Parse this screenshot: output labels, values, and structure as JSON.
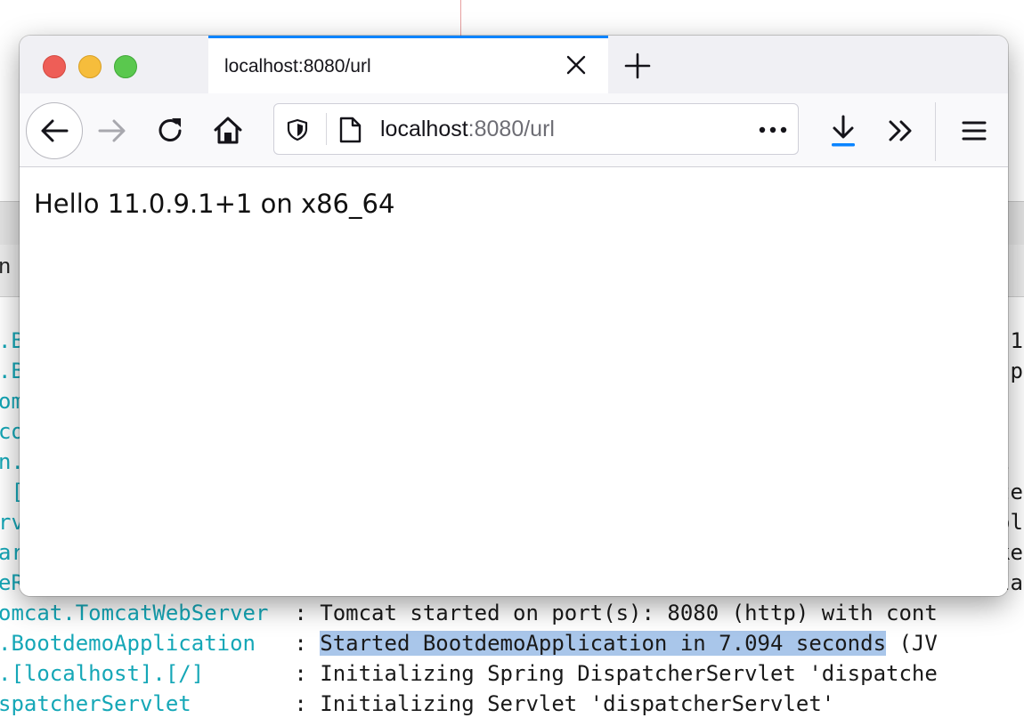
{
  "browser": {
    "tab": {
      "title": "localhost:8080/url"
    },
    "address": {
      "host": "localhost",
      "rest": ":8080/url"
    },
    "page": {
      "text": "Hello 11.0.9.1+1 on x86_64"
    }
  },
  "console": {
    "tab_label": "n (",
    "left_fragments": [
      ".B",
      ".B",
      "om",
      "co",
      "n.",
      " [",
      "rv",
      "ar",
      "eR"
    ],
    "right_fragments": [
      ".1",
      " p",
      "",
      "",
      "l",
      "te",
      "ol",
      "ke",
      "la"
    ],
    "lines": [
      {
        "logger": "omcat.TomcatWebServer  ",
        "sep": ": ",
        "msg": "Tomcat started on port(s): 8080 (http) with cont",
        "highlight": "",
        "tail": ""
      },
      {
        "logger": ".BootdemoApplication   ",
        "sep": ": ",
        "msg": "",
        "highlight": "Started BootdemoApplication in 7.094 seconds",
        "tail": " (JV"
      },
      {
        "logger": ".[localhost].[/]       ",
        "sep": ": ",
        "msg": "Initializing Spring DispatcherServlet 'dispatche",
        "highlight": "",
        "tail": ""
      },
      {
        "logger": "spatcherServlet        ",
        "sep": ": ",
        "msg": "Initializing Servlet 'dispatcherServlet'",
        "highlight": "",
        "tail": ""
      }
    ]
  },
  "colors": {
    "tab_accent": "#0a84ff",
    "logger": "#15a7b7",
    "selection": "#a9c6ea"
  }
}
